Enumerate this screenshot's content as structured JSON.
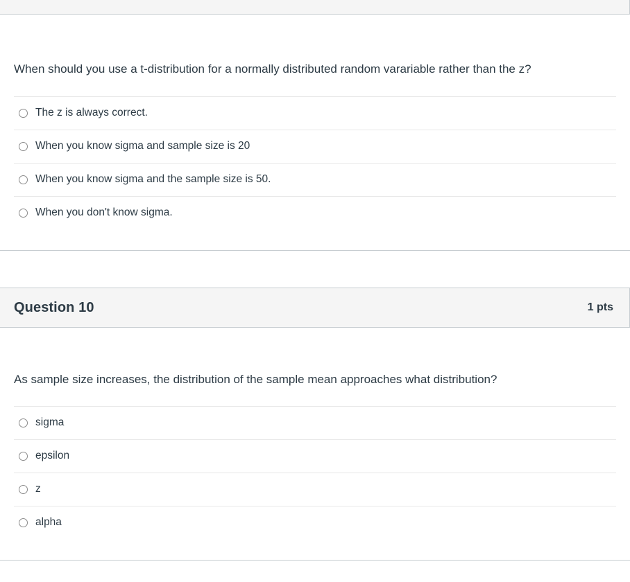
{
  "page": {
    "background_color": "#ffffff",
    "text_color": "#2d3b45",
    "header_bg_color": "#f5f5f5",
    "border_color": "#c7cdd1",
    "divider_color": "#e8e8e8"
  },
  "questions": [
    {
      "header_visible": false,
      "name": "",
      "points": "",
      "text": "When should you use a t-distribution for a normally distributed random varariable rather than the z?",
      "answers": [
        {
          "label": "The z is always correct.",
          "selected": false
        },
        {
          "label": "When you know sigma and sample size is 20",
          "selected": false
        },
        {
          "label": "When you know sigma and the sample size is 50.",
          "selected": false
        },
        {
          "label": "When you don't know sigma.",
          "selected": false
        }
      ]
    },
    {
      "header_visible": true,
      "name": "Question 10",
      "points": "1 pts",
      "text": "As sample size increases, the distribution of the sample mean approaches what distribution?",
      "answers": [
        {
          "label": "sigma",
          "selected": false
        },
        {
          "label": "epsilon",
          "selected": false
        },
        {
          "label": "z",
          "selected": false
        },
        {
          "label": "alpha",
          "selected": false
        }
      ]
    }
  ]
}
